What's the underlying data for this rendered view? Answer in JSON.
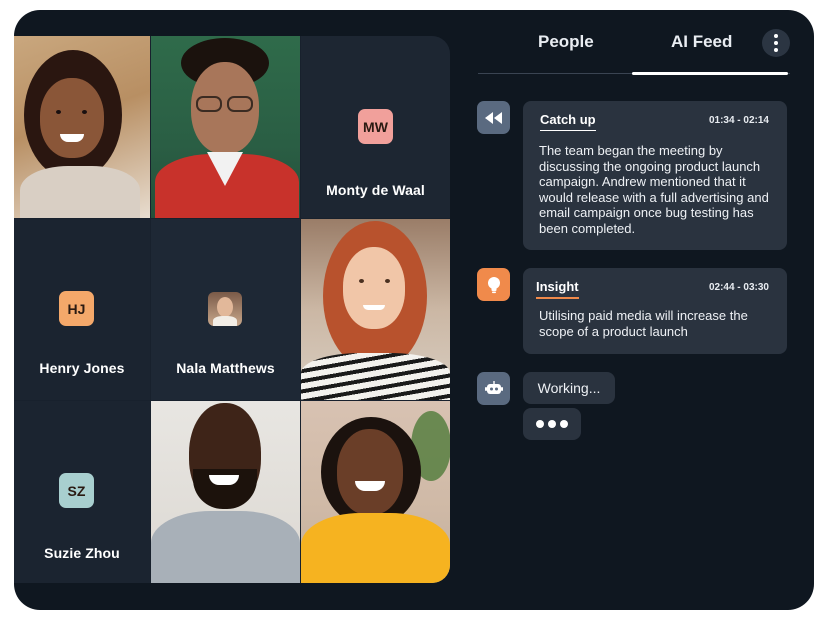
{
  "participants": [
    {
      "name": "",
      "kind": "video"
    },
    {
      "name": "",
      "kind": "video"
    },
    {
      "name": "Monty de Waal",
      "initials": "MW",
      "badge_color": "#f1a09b"
    },
    {
      "name": "Henry Jones",
      "initials": "HJ",
      "badge_color": "#f4a86a"
    },
    {
      "name": "Nala Matthews",
      "kind": "mini-photo"
    },
    {
      "name": "",
      "kind": "video"
    },
    {
      "name": "Suzie Zhou",
      "initials": "SZ",
      "badge_color": "#a8cfcf"
    },
    {
      "name": "",
      "kind": "video"
    },
    {
      "name": "",
      "kind": "video"
    }
  ],
  "tabs": [
    {
      "label": "People",
      "active": false
    },
    {
      "label": "AI Feed",
      "active": true
    }
  ],
  "more_menu_icon": "vertical-ellipsis-icon",
  "feed": [
    {
      "icon": "rewind-icon",
      "icon_color": "#5a6a80",
      "title": "Catch up",
      "time": "01:34 - 02:14",
      "body": "The team began the meeting by discussing the ongoing product launch campaign. Andrew mentioned that it would release with a full advertising and email campaign once bug testing has been completed."
    },
    {
      "icon": "lightbulb-icon",
      "icon_color": "#f08a4b",
      "title": "Insight",
      "title_underline_color": "#f08a4b",
      "time": "02:44 - 03:30",
      "body": "Utilising paid media will increase the scope of a product launch"
    },
    {
      "icon": "robot-icon",
      "icon_color": "#5a6a80",
      "status": "Working..."
    }
  ],
  "colors": {
    "background": "#0f1720",
    "card": "#2a333f",
    "accent": "#f08a4b"
  }
}
